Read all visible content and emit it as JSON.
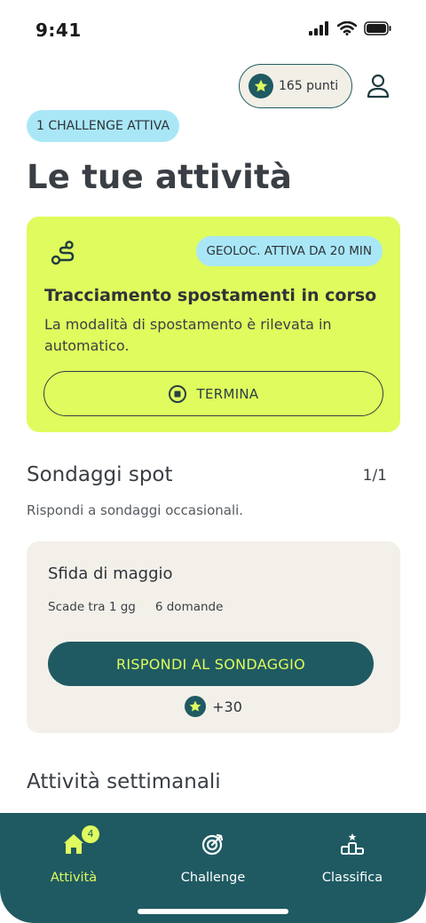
{
  "status_bar": {
    "time": "9:41"
  },
  "header": {
    "points_label": "165 punti"
  },
  "challenge_badge": "1 CHALLENGE ATTIVA",
  "page_title": "Le tue attività",
  "tracking_card": {
    "status_badge": "GEOLOC. ATTIVA DA 20 MIN",
    "title": "Tracciamento spostamenti in corso",
    "description": "La modalità di spostamento è rilevata in automatico.",
    "stop_label": "TERMINA"
  },
  "spot_surveys": {
    "title": "Sondaggi spot",
    "counter": "1/1",
    "subtitle": "Rispondi a sondaggi occasionali.",
    "card": {
      "title": "Sfida di maggio",
      "expires": "Scade tra 1 gg",
      "questions": "6 domande",
      "button_label": "RISPONDI AL SONDAGGIO",
      "reward": "+30"
    }
  },
  "weekly": {
    "title": "Attività settimanali"
  },
  "tab_bar": {
    "tabs": [
      {
        "label": "Attività",
        "icon": "home-icon",
        "badge": "4"
      },
      {
        "label": "Challenge",
        "icon": "target-icon"
      },
      {
        "label": "Classifica",
        "icon": "podium-icon"
      }
    ]
  },
  "colors": {
    "accent_lime": "#dffb5e",
    "primary_teal": "#1f5a62",
    "badge_blue": "#a9e7f7",
    "card_beige": "#f3f0ea"
  }
}
